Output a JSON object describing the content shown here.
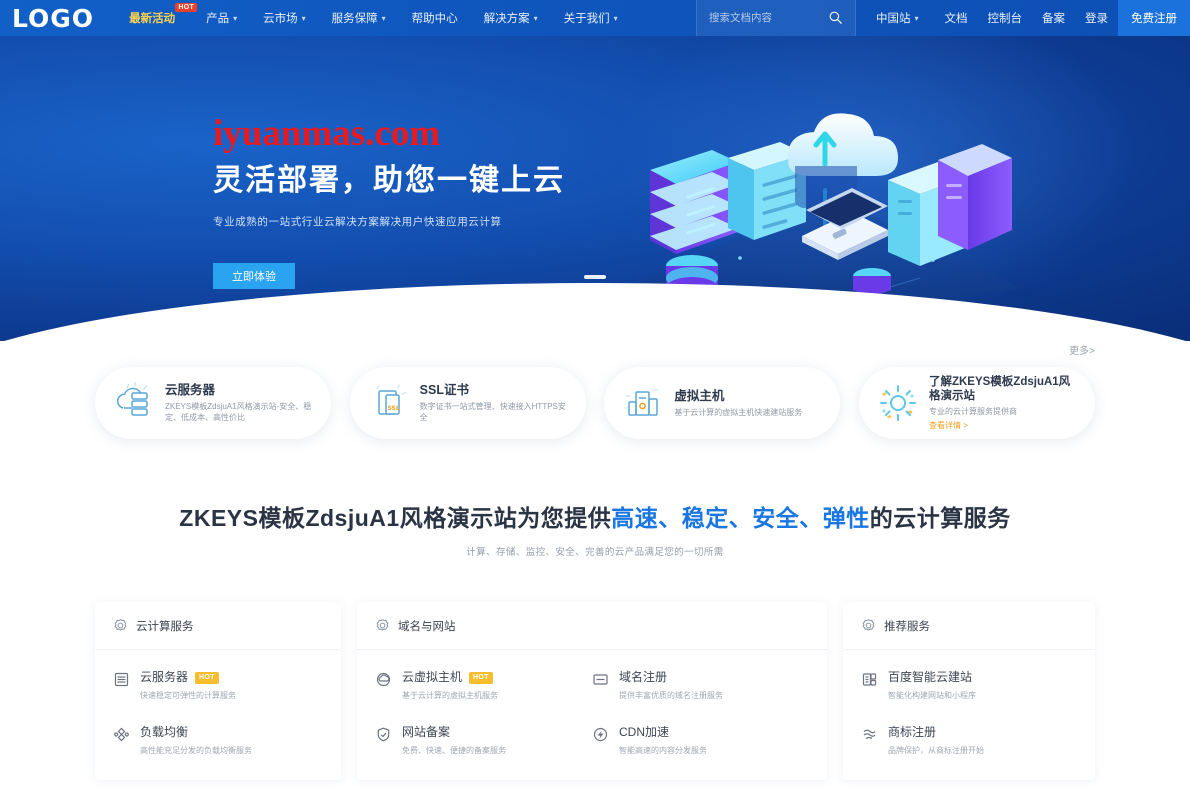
{
  "nav": {
    "logo": "LOGO",
    "items": [
      {
        "label": "最新活动",
        "badge": "HOT",
        "caret": false,
        "highlight": true
      },
      {
        "label": "产品",
        "caret": true
      },
      {
        "label": "云市场",
        "caret": true
      },
      {
        "label": "服务保障",
        "caret": true
      },
      {
        "label": "帮助中心",
        "caret": false
      },
      {
        "label": "解决方案",
        "caret": true
      },
      {
        "label": "关于我们",
        "caret": true
      }
    ],
    "search_placeholder": "搜索文档内容",
    "search_value": "",
    "region": "中国站",
    "links": [
      "文档",
      "控制台",
      "备案",
      "登录"
    ],
    "register_label": "免费注册"
  },
  "hero": {
    "watermark": "iyuanmas.com",
    "title": "灵活部署，助您一键上云",
    "subtitle": "专业成熟的一站式行业云解决方案解决用户快速应用云计算",
    "button": "立即体验"
  },
  "more_link": "更多>",
  "cards": [
    {
      "icon": "cloud-server-icon",
      "title": "云服务器",
      "desc": "ZKEYS模板ZdsjuA1风格演示站-安全、稳定、低成本、高性价比"
    },
    {
      "icon": "ssl-certificate-icon",
      "title": "SSL证书",
      "desc": "数字证书一站式管理、快速接入HTTPS安全"
    },
    {
      "icon": "virtual-host-icon",
      "title": "虚拟主机",
      "desc": "基于云计算的虚拟主机快速建站服务"
    },
    {
      "icon": "sun-burst-icon",
      "title": "了解ZKEYS模板ZdsjuA1风格演示站",
      "desc": "专业的云计算服务提供商",
      "more": "查看详情 >"
    }
  ],
  "section": {
    "title_prefix": "ZKEYS模板ZdsjuA1风格演示站为您提供",
    "title_highlight": "高速、稳定、安全、弹性",
    "title_suffix": "的云计算服务",
    "subtitle": "计算、存储、监控、安全、完善的云产品满足您的一切所需"
  },
  "services": [
    {
      "icon": "gear-icon",
      "title": "云计算服务",
      "items": [
        {
          "icon": "server-rack-icon",
          "title": "云服务器",
          "badge": "HOT",
          "desc": "快速稳定可弹性的计算服务"
        },
        {
          "icon": "load-balance-icon",
          "title": "负载均衡",
          "desc": "高性能充足分发的负载均衡服务"
        }
      ]
    },
    {
      "icon": "gear-icon",
      "title": "域名与网站",
      "items": [
        {
          "icon": "cloud-host-icon",
          "title": "云虚拟主机",
          "badge": "HOT",
          "desc": "基于云计算的虚拟主机服务"
        },
        {
          "icon": "domain-register-icon",
          "title": "域名注册",
          "desc": "提供丰富优质的域名注册服务"
        },
        {
          "icon": "shield-icon",
          "title": "网站备案",
          "desc": "免费、快速、便捷的备案服务"
        },
        {
          "icon": "cdn-icon",
          "title": "CDN加速",
          "desc": "智能高速的内容分发服务"
        }
      ]
    },
    {
      "icon": "gear-icon",
      "title": "推荐服务",
      "items": [
        {
          "icon": "site-builder-icon",
          "title": "百度智能云建站",
          "desc": "智能化构建网站和小程序"
        },
        {
          "icon": "trademark-icon",
          "title": "商标注册",
          "desc": "品牌保护，从商标注册开始"
        }
      ]
    }
  ],
  "colors": {
    "nav_bg": "#0f56bd",
    "accent_blue": "#1976e2",
    "hero_btn": "#2aa3f0",
    "hot_red": "#e8402a",
    "hot_yellow": "#f6bd2e",
    "watermark_red": "#e8191f"
  }
}
